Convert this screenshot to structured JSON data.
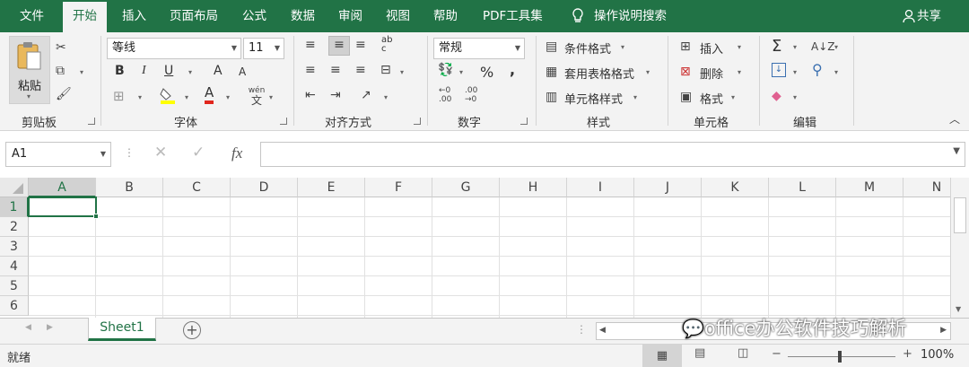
{
  "tabs": [
    "文件",
    "开始",
    "插入",
    "页面布局",
    "公式",
    "数据",
    "审阅",
    "视图",
    "帮助",
    "PDF工具集"
  ],
  "tell_me": "操作说明搜索",
  "share": "共享",
  "clipboard": {
    "paste": "粘贴",
    "label": "剪贴板"
  },
  "font": {
    "name": "等线",
    "size": "11",
    "bold": "B",
    "italic": "I",
    "underline": "U",
    "grow": "A",
    "shrink": "A",
    "color_a": "A",
    "phonetic": "文",
    "label": "字体"
  },
  "alignment": {
    "label": "对齐方式",
    "wrap": "ab",
    "wrap2": "c"
  },
  "number": {
    "format": "常规",
    "percent": "%",
    "comma": ",",
    "label": "数字"
  },
  "styles": {
    "conditional": "条件格式",
    "table": "套用表格格式",
    "cell": "单元格样式",
    "label": "样式"
  },
  "cells": {
    "insert": "插入",
    "delete": "删除",
    "format": "格式",
    "label": "单元格"
  },
  "editing": {
    "sum": "Σ",
    "label": "编辑"
  },
  "formula_bar": {
    "name_box": "A1",
    "fx": "fx",
    "content": ""
  },
  "columns": [
    "A",
    "B",
    "C",
    "D",
    "E",
    "F",
    "G",
    "H",
    "I",
    "J",
    "K",
    "L",
    "M",
    "N"
  ],
  "rows": [
    "1",
    "2",
    "3",
    "4",
    "5",
    "6"
  ],
  "sheet": {
    "name": "Sheet1",
    "add": "+"
  },
  "watermark": "office办公软件技巧解析",
  "status": {
    "ready": "就绪",
    "zoom": "100%"
  }
}
